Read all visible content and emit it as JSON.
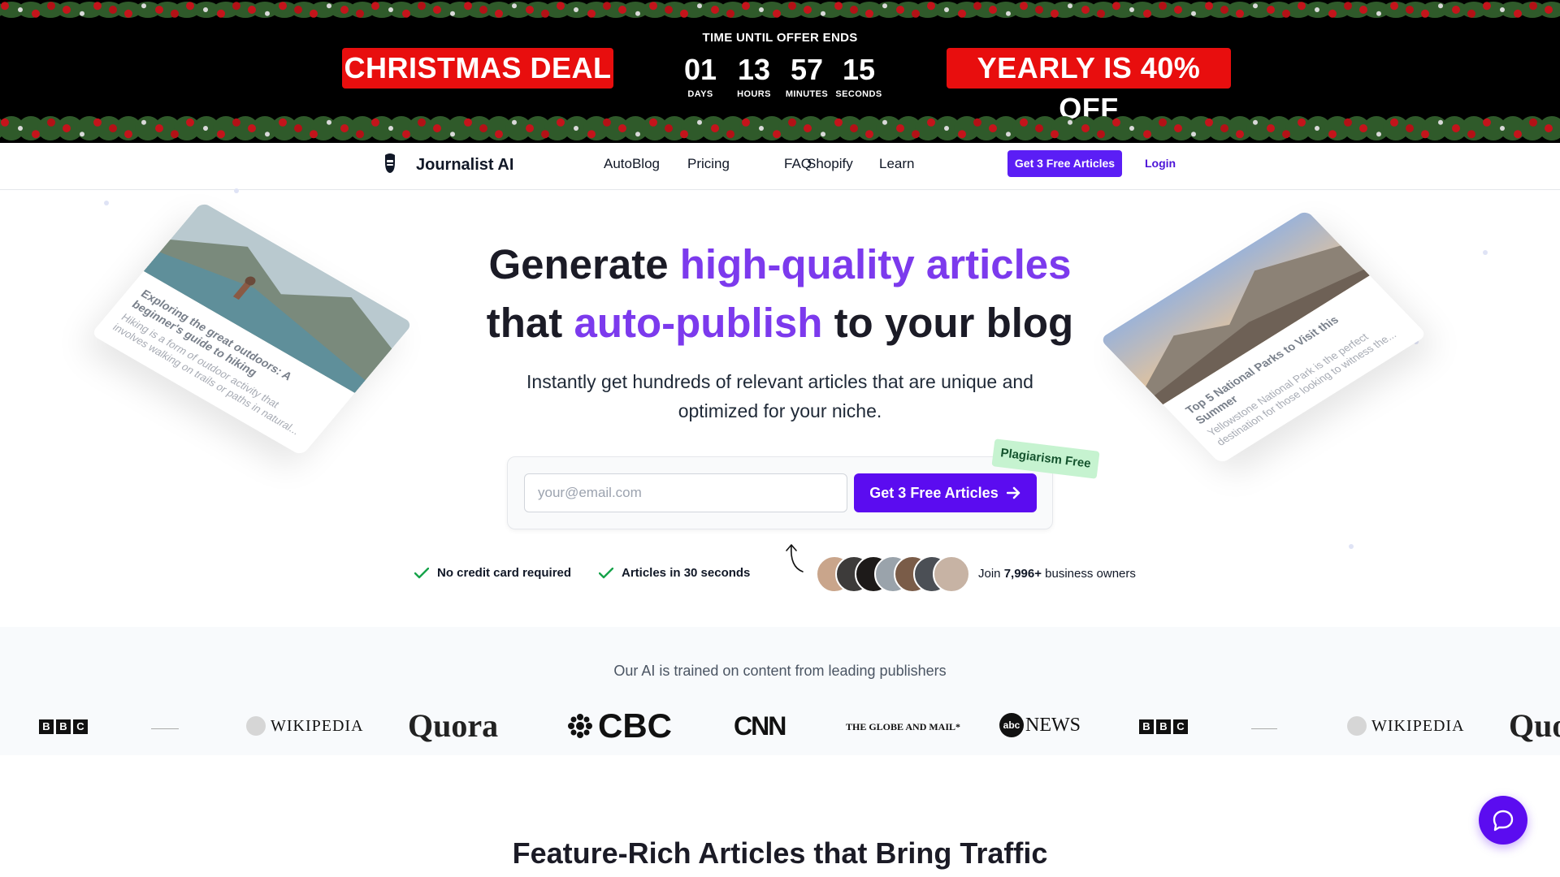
{
  "promo": {
    "left_badge": "CHRISTMAS DEAL",
    "right_badge": "YEARLY IS 40% OFF",
    "timer_title": "TIME UNTIL OFFER ENDS",
    "timer": [
      {
        "value": "01",
        "label": "DAYS"
      },
      {
        "value": "13",
        "label": "HOURS"
      },
      {
        "value": "57",
        "label": "MINUTES"
      },
      {
        "value": "15",
        "label": "SECONDS"
      }
    ],
    "badge_color": "#e80e0e"
  },
  "nav": {
    "brand": "Journalist AI",
    "links": [
      "AutoBlog",
      "Pricing",
      "FAQ",
      "Shopify",
      "Learn"
    ],
    "cta": "Get 3 Free Articles",
    "login": "Login"
  },
  "hero": {
    "title_pre1": "Generate ",
    "title_accent1": "high-quality articles",
    "title_pre2": "that ",
    "title_accent2": "auto-publish",
    "title_post2": " to your blog",
    "subtitle": "Instantly get hundreds of relevant articles that are unique and optimized for your niche.",
    "email_placeholder": "your@email.com",
    "cta": "Get 3 Free Articles",
    "badge": "Plagiarism Free",
    "checks": [
      "No credit card required",
      "Articles in 30 seconds"
    ],
    "join_pre": "Join ",
    "join_count": "7,996+",
    "join_post": " business owners",
    "accent_color": "#7c3aed"
  },
  "cards": {
    "left": {
      "title": "Exploring the great outdoors: A beginner's guide to hiking",
      "body": "Hiking is a form of outdoor activity that involves walking on trails or paths in natural..."
    },
    "right": {
      "title": "Top 5 National Parks to Visit this Summer",
      "body": "Yellowstone National Park is the perfect destination for those looking to witness the..."
    }
  },
  "publishers": {
    "title": "Our AI is trained on content from leading publishers",
    "logos": [
      "BBC",
      "WIKIPEDIA",
      "Quora",
      "CBC",
      "CNN",
      "THE GLOBE AND MAIL",
      "abcNEWS",
      "BBC",
      "WIKIPEDIA",
      "Quo"
    ]
  },
  "features": {
    "title": "Feature-Rich Articles that Bring Traffic"
  }
}
